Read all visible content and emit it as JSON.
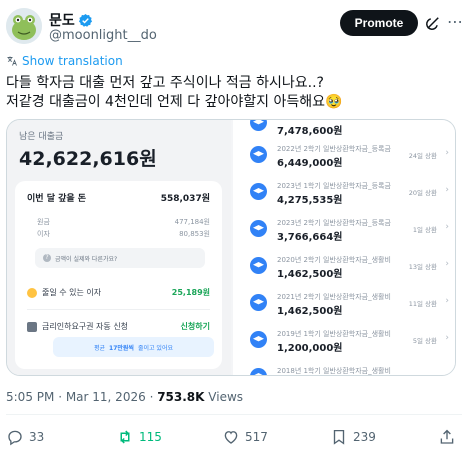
{
  "author": {
    "display_name": "문도",
    "handle": "@moonlight__do",
    "verified": true
  },
  "header": {
    "promote_label": "Promote"
  },
  "translate_label": "Show translation",
  "tweet_lines": [
    "다들 학자금 대출 먼저 갚고 주식이나 적금 하시나요..?",
    "저같경 대출금이 4천인데 언제 다 갚아야할지 아득해요🥹"
  ],
  "media": {
    "left": {
      "remaining_label": "남은 대출금",
      "remaining_amount": "42,622,616원",
      "pay_title": "이번 달 갚을 돈",
      "pay_total": "558,037원",
      "principal_label": "원금",
      "principal_value": "477,184원",
      "interest_label": "이자",
      "interest_value": "80,853원",
      "help_text": "금액이 실제와 다른가요?",
      "savable_interest_label": "줄일 수 있는 이자",
      "savable_interest_value": "25,189원",
      "auto_apply_label": "금리인하요구권 자동 신청",
      "auto_apply_link": "신청하기",
      "banner_prefix": "평균",
      "banner_bold": "17만원씩",
      "banner_suffix": "줄이고 있어요"
    },
    "loans": [
      {
        "name": "",
        "amount": "7,478,600원",
        "due": ""
      },
      {
        "name": "2022년 2학기 일반상환학자금_등록금",
        "amount": "6,449,000원",
        "due": "24일 상환"
      },
      {
        "name": "2023년 1학기 일반상환학자금_등록금",
        "amount": "4,275,535원",
        "due": "20일 상환"
      },
      {
        "name": "2023년 2학기 일반상환학자금_등록금",
        "amount": "3,766,664원",
        "due": "1일 상환"
      },
      {
        "name": "2020년 2학기 일반상환학자금_생활비",
        "amount": "1,462,500원",
        "due": "13일 상환"
      },
      {
        "name": "2021년 2학기 일반상환학자금_생활비",
        "amount": "1,462,500원",
        "due": "11일 상환"
      },
      {
        "name": "2019년 1학기 일반상환학자금_생활비",
        "amount": "1,200,000원",
        "due": "5일 상환"
      },
      {
        "name": "2018년 1학기 일반상환학자금_생활비",
        "amount": "",
        "due": ""
      }
    ]
  },
  "meta": {
    "time": "5:05 PM",
    "date": "Mar 11, 2026",
    "views": "753.8K",
    "views_label": "Views"
  },
  "actions": {
    "replies": "33",
    "reposts": "115",
    "likes": "517",
    "bookmarks": "239"
  },
  "colors": {
    "accent_blue": "#1d9bf0",
    "repost_green": "#00ba7c",
    "toss_blue": "#3182f6",
    "toss_green": "#1ba659"
  }
}
